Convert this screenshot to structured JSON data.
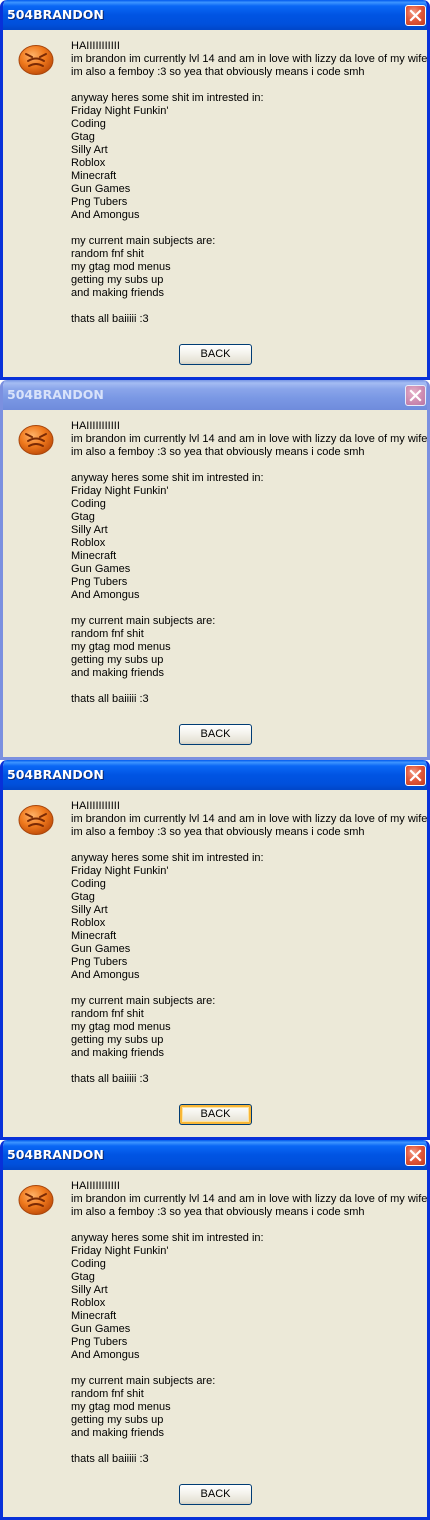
{
  "windows": [
    {
      "title": "504BRANDON",
      "state": "active",
      "message": [
        "HAIIIIIIIIIII",
        "im brandon im currently lvl 14 and am in love with lizzy da love of my wife",
        "im also a femboy :3 so yea that obviously means i code smh",
        "",
        "anyway heres some shit im intrested in:",
        "Friday Night Funkin'",
        "Coding",
        "Gtag",
        "Silly Art",
        "Roblox",
        "Minecraft",
        "Gun Games",
        "Png Tubers",
        "And Amongus",
        "",
        "my current main subjects are:",
        "random fnf shit",
        "my gtag mod menus",
        "getting my subs up",
        "and making friends",
        "",
        "thats all baiiiii :3"
      ],
      "button_label": "BACK",
      "button_state": "normal"
    },
    {
      "title": "504BRANDON",
      "state": "inactive",
      "message": [
        "HAIIIIIIIIIII",
        "im brandon im currently lvl 14 and am in love with lizzy da love of my wife",
        "im also a femboy :3 so yea that obviously means i code smh",
        "",
        "anyway heres some shit im intrested in:",
        "Friday Night Funkin'",
        "Coding",
        "Gtag",
        "Silly Art",
        "Roblox",
        "Minecraft",
        "Gun Games",
        "Png Tubers",
        "And Amongus",
        "",
        "my current main subjects are:",
        "random fnf shit",
        "my gtag mod menus",
        "getting my subs up",
        "and making friends",
        "",
        "thats all baiiiii :3"
      ],
      "button_label": "BACK",
      "button_state": "normal"
    },
    {
      "title": "504BRANDON",
      "state": "active",
      "message": [
        "HAIIIIIIIIIII",
        "im brandon im currently lvl 14 and am in love with lizzy da love of my wife",
        "im also a femboy :3 so yea that obviously means i code smh",
        "",
        "anyway heres some shit im intrested in:",
        "Friday Night Funkin'",
        "Coding",
        "Gtag",
        "Silly Art",
        "Roblox",
        "Minecraft",
        "Gun Games",
        "Png Tubers",
        "And Amongus",
        "",
        "my current main subjects are:",
        "random fnf shit",
        "my gtag mod menus",
        "getting my subs up",
        "and making friends",
        "",
        "thats all baiiiii :3"
      ],
      "button_label": "BACK",
      "button_state": "hover"
    },
    {
      "title": "504BRANDON",
      "state": "active",
      "message": [
        "HAIIIIIIIIIII",
        "im brandon im currently lvl 14 and am in love with lizzy da love of my wife",
        "im also a femboy :3 so yea that obviously means i code smh",
        "",
        "anyway heres some shit im intrested in:",
        "Friday Night Funkin'",
        "Coding",
        "Gtag",
        "Silly Art",
        "Roblox",
        "Minecraft",
        "Gun Games",
        "Png Tubers",
        "And Amongus",
        "",
        "my current main subjects are:",
        "random fnf shit",
        "my gtag mod menus",
        "getting my subs up",
        "and making friends",
        "",
        "thats all baiiiii :3"
      ],
      "button_label": "BACK",
      "button_state": "pressed"
    }
  ],
  "icon": "orange-frowning-face-icon",
  "colors": {
    "active_title": "#0054e3",
    "inactive_title": "#7a98e4",
    "dialog_background": "#ece9d8",
    "close_button": "#e2583b",
    "hover_highlight": "#f8b636"
  }
}
